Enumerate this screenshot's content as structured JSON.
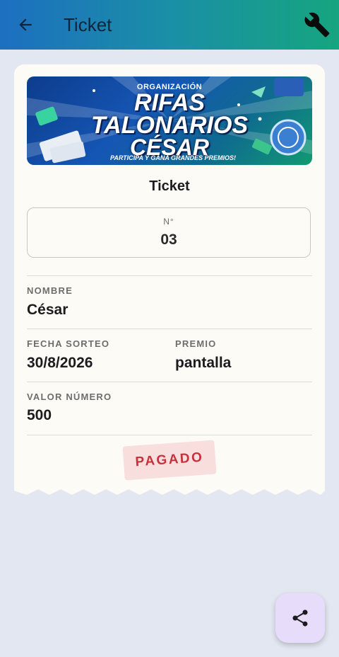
{
  "appbar": {
    "title": "Ticket",
    "back_icon": "arrow-left-icon",
    "settings_icon": "wrench-icon"
  },
  "banner": {
    "org": "ORGANIZACIÓN",
    "line1": "RIFAS",
    "line2": "TALONARIOS",
    "line3": "CÉSAR",
    "tagline": "PARTICIPA Y GANA GRANDES PREMIOS!"
  },
  "ticket": {
    "heading": "Ticket",
    "number_label": "N°",
    "number": "03",
    "nombre_label": "NOMBRE",
    "nombre": "César",
    "fecha_label": "FECHA SORTEO",
    "fecha": "30/8/2026",
    "premio_label": "PREMIO",
    "premio": "pantalla",
    "valor_label": "VALOR NÚMERO",
    "valor": "500",
    "status": "PAGADO"
  },
  "fab": {
    "icon": "share-icon"
  },
  "colors": {
    "appbar_start": "#1d6fc0",
    "appbar_end": "#16a57f",
    "card_bg": "#fdfbf5",
    "page_bg": "#e3e7f1",
    "stamp_bg": "#f9dede",
    "stamp_text": "#c8313b",
    "fab_bg": "#e8dcfb"
  }
}
